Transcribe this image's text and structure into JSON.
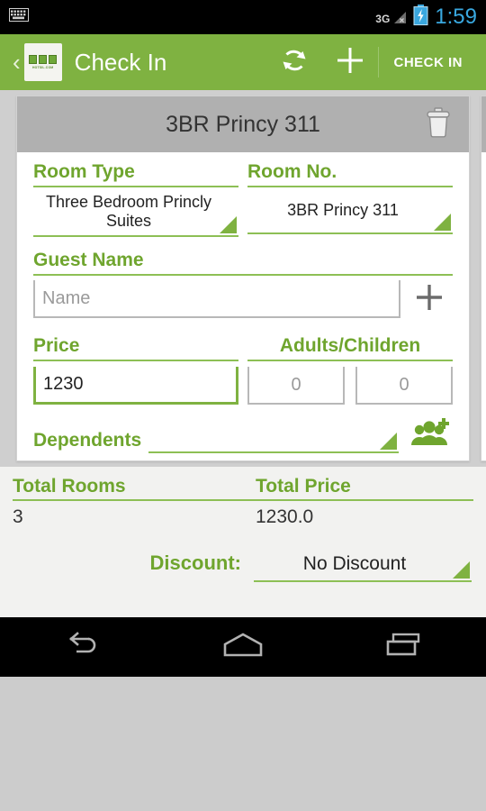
{
  "statusbar": {
    "keyboard_icon": "keyboard-icon",
    "network_label": "3G",
    "signal_icon": "signal-no-service-icon",
    "battery_icon": "battery-charging-icon",
    "time": "1:59"
  },
  "actionbar": {
    "back_glyph": "‹",
    "logo_text": "HOTSIL.COM",
    "title": "Check In",
    "refresh_icon": "refresh-icon",
    "add_icon": "plus-icon",
    "checkin_label": "CHECK IN"
  },
  "card": {
    "title": "3BR Princy 311",
    "delete_icon": "trash-icon",
    "room_type": {
      "label": "Room Type",
      "value": "Three Bedroom Princly Suites"
    },
    "room_no": {
      "label": "Room No.",
      "value": "3BR Princy 311"
    },
    "guest_name": {
      "label": "Guest Name",
      "value": "",
      "placeholder": "Name",
      "add_icon": "plus-icon"
    },
    "price": {
      "label": "Price",
      "value": "1230"
    },
    "adults_children": {
      "label": "Adults/Children",
      "adults_value": "",
      "adults_placeholder": "0",
      "children_value": "",
      "children_placeholder": "0"
    },
    "dependents": {
      "label": "Dependents",
      "value": "",
      "add_icon": "add-group-icon"
    }
  },
  "summary": {
    "total_rooms_label": "Total Rooms",
    "total_rooms_value": "3",
    "total_price_label": "Total Price",
    "total_price_value": "1230.0",
    "discount_label": "Discount:",
    "discount_value": "No Discount"
  },
  "navbar": {
    "back_icon": "back-icon",
    "home_icon": "home-icon",
    "recents_icon": "recent-apps-icon"
  },
  "colors": {
    "brand_green": "#7fb241",
    "label_green": "#6fa52e",
    "rule_green": "#8dbf55",
    "card_header_gray": "#b0b0b0",
    "pager_bg": "#cfcfcf",
    "summary_bg": "#f2f2f0",
    "status_time_blue": "#39a8e0"
  }
}
